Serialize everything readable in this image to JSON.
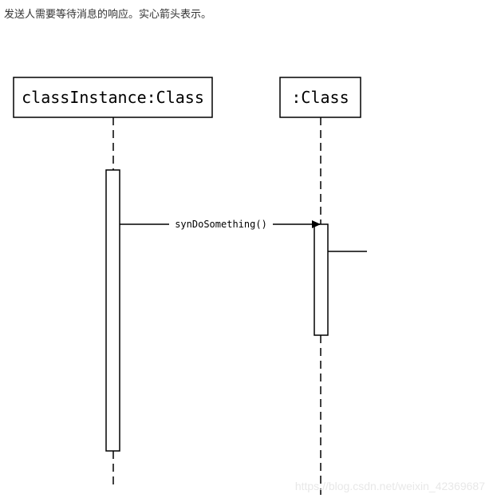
{
  "caption": "发送人需要等待消息的响应。实心箭头表示。",
  "lifelines": [
    {
      "name": "classInstance:Class"
    },
    {
      "name": ":Class"
    }
  ],
  "message": {
    "label": "synDoSomething()",
    "arrow": "solid"
  },
  "watermark": "https://blog.csdn.net/weixin_42369687"
}
